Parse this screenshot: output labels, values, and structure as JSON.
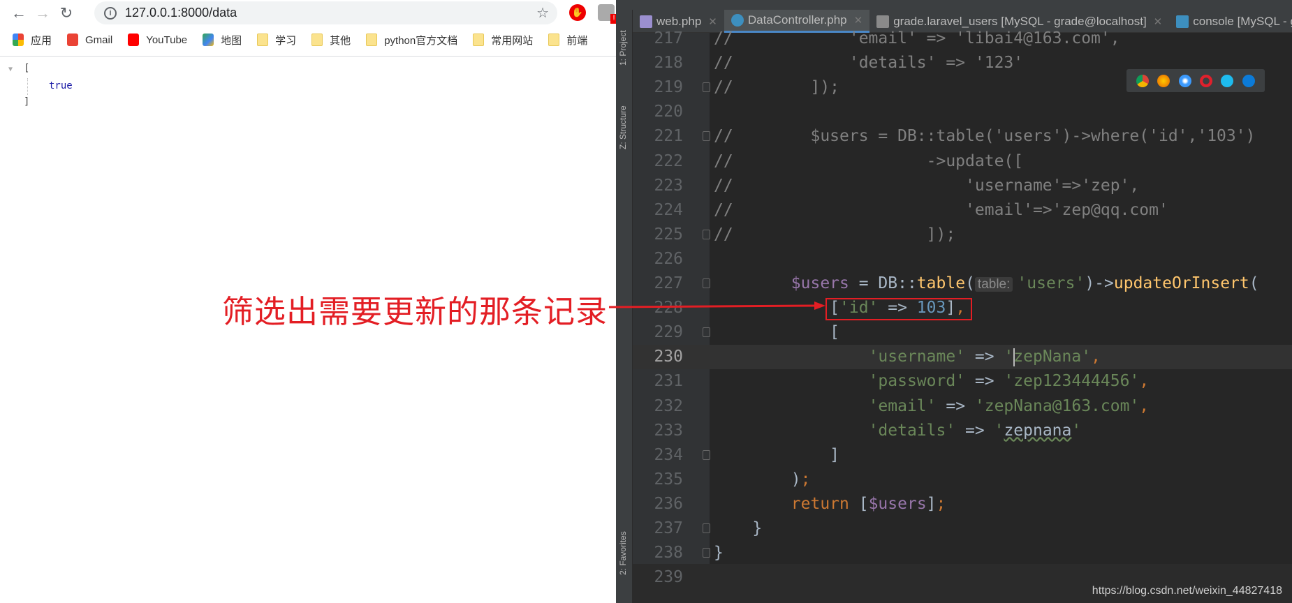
{
  "browser": {
    "url": "127.0.0.1:8000/data",
    "bookmarks": [
      {
        "label": "应用",
        "icon": "apps-grid-icon"
      },
      {
        "label": "Gmail",
        "icon": "gmail-icon"
      },
      {
        "label": "YouTube",
        "icon": "youtube-icon"
      },
      {
        "label": "地图",
        "icon": "maps-icon"
      },
      {
        "label": "学习",
        "icon": "folder-icon"
      },
      {
        "label": "其他",
        "icon": "folder-icon"
      },
      {
        "label": "python官方文档",
        "icon": "folder-icon"
      },
      {
        "label": "常用网站",
        "icon": "folder-icon"
      },
      {
        "label": "前端",
        "icon": "folder-icon"
      }
    ],
    "json_open": "[",
    "json_value": "true",
    "json_close": "]"
  },
  "annotation": {
    "text": "筛选出需要更新的那条记录",
    "color": "#e31e24"
  },
  "ide": {
    "tool_windows": [
      "1: Project",
      "Z: Structure",
      "2: Favorites"
    ],
    "tabs": [
      {
        "label": "web.php",
        "active": false
      },
      {
        "label": "DataController.php",
        "active": true
      },
      {
        "label": "grade.laravel_users [MySQL - grade@localhost]",
        "active": false
      },
      {
        "label": "console [MySQL - grade",
        "active": false
      }
    ],
    "current_line": 230,
    "lines": [
      {
        "n": 217,
        "tokens": [
          [
            "//            'email' => 'libai4@163.com',",
            "comment"
          ]
        ]
      },
      {
        "n": 218,
        "tokens": [
          [
            "//            'details' => '123'",
            "comment"
          ]
        ]
      },
      {
        "n": 219,
        "fold": true,
        "tokens": [
          [
            "//        ]);",
            "comment"
          ]
        ]
      },
      {
        "n": 220,
        "tokens": []
      },
      {
        "n": 221,
        "fold": true,
        "tokens": [
          [
            "//        $users = DB::table('users')->where('id','103')",
            "comment"
          ]
        ]
      },
      {
        "n": 222,
        "tokens": [
          [
            "//                    ->update([",
            "comment"
          ]
        ]
      },
      {
        "n": 223,
        "tokens": [
          [
            "//                        'username'=>'zep',",
            "comment"
          ]
        ]
      },
      {
        "n": 224,
        "tokens": [
          [
            "//                        'email'=>'zep@qq.com'",
            "comment"
          ]
        ]
      },
      {
        "n": 225,
        "fold": true,
        "tokens": [
          [
            "//                    ]);",
            "comment"
          ]
        ]
      },
      {
        "n": 226,
        "tokens": []
      },
      {
        "n": 227,
        "fold": true,
        "tokens": [
          [
            "        ",
            ""
          ],
          [
            "$users",
            "var"
          ],
          [
            " = DB::",
            ""
          ],
          [
            "table",
            "fn"
          ],
          [
            "(",
            ""
          ],
          [
            "table:",
            "hint"
          ],
          [
            "'users'",
            "str"
          ],
          [
            ")->",
            ""
          ],
          [
            "updateOrInsert",
            "fn"
          ],
          [
            "(",
            ""
          ]
        ]
      },
      {
        "n": 228,
        "tokens": [
          [
            "            [",
            ""
          ],
          [
            "'id'",
            "str"
          ],
          [
            " => ",
            ""
          ],
          [
            "103",
            "num"
          ],
          [
            "]",
            ""
          ],
          [
            ",",
            "punc"
          ]
        ]
      },
      {
        "n": 229,
        "fold": true,
        "tokens": [
          [
            "            [",
            ""
          ]
        ]
      },
      {
        "n": 230,
        "tokens": [
          [
            "                ",
            ""
          ],
          [
            "'username'",
            "str"
          ],
          [
            " => ",
            ""
          ],
          [
            "'",
            "str"
          ],
          [
            "|",
            "caret"
          ],
          [
            "zepNana'",
            "str"
          ],
          [
            ",",
            "punc"
          ]
        ]
      },
      {
        "n": 231,
        "tokens": [
          [
            "                ",
            ""
          ],
          [
            "'password'",
            "str"
          ],
          [
            " => ",
            ""
          ],
          [
            "'zep123444456'",
            "str"
          ],
          [
            ",",
            "punc"
          ]
        ]
      },
      {
        "n": 232,
        "tokens": [
          [
            "                ",
            ""
          ],
          [
            "'email'",
            "str"
          ],
          [
            " => ",
            ""
          ],
          [
            "'zepNana@163.com'",
            "str"
          ],
          [
            ",",
            "punc"
          ]
        ]
      },
      {
        "n": 233,
        "tokens": [
          [
            "                ",
            ""
          ],
          [
            "'details'",
            "str"
          ],
          [
            " => ",
            ""
          ],
          [
            "'",
            "str"
          ],
          [
            "zepnana",
            "warn"
          ],
          [
            "'",
            "str"
          ]
        ]
      },
      {
        "n": 234,
        "fold": true,
        "tokens": [
          [
            "            ]",
            ""
          ]
        ]
      },
      {
        "n": 235,
        "tokens": [
          [
            "        )",
            ""
          ],
          [
            ";",
            "punc"
          ]
        ]
      },
      {
        "n": 236,
        "tokens": [
          [
            "        ",
            ""
          ],
          [
            "return",
            "kw"
          ],
          [
            " [",
            ""
          ],
          [
            "$users",
            "var"
          ],
          [
            "]",
            ""
          ],
          [
            ";",
            "punc"
          ]
        ]
      },
      {
        "n": 237,
        "fold": true,
        "tokens": [
          [
            "    }",
            ""
          ]
        ]
      },
      {
        "n": 238,
        "fold": true,
        "tokens": [
          [
            "}",
            ""
          ]
        ]
      },
      {
        "n": 239,
        "tokens": []
      }
    ],
    "browser_icons": [
      "chrome-icon",
      "firefox-icon",
      "safari-icon",
      "opera-icon",
      "ie-icon",
      "edge-icon"
    ]
  },
  "watermark": "https://blog.csdn.net/weixin_44827418"
}
